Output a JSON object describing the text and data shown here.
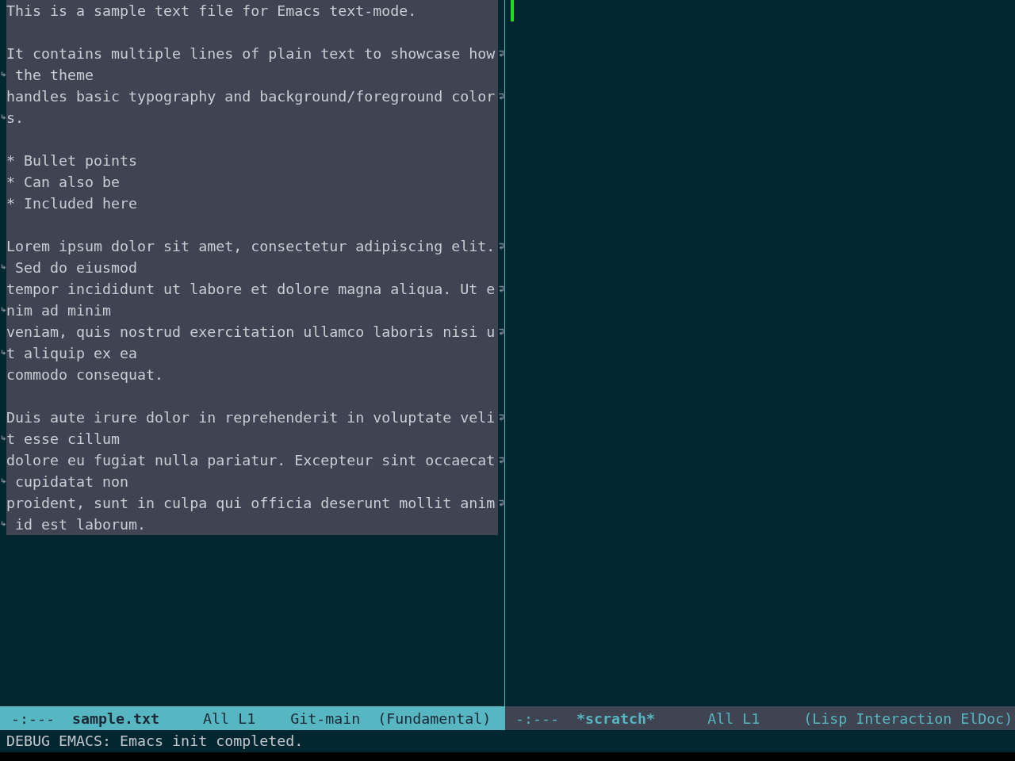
{
  "windows": [
    {
      "region": true,
      "lines": [
        {
          "kind": "text",
          "rows": [
            "This is a sample text file for Emacs text-mode."
          ]
        },
        {
          "kind": "blank"
        },
        {
          "kind": "text",
          "rows": [
            "It contains multiple lines of plain text to showcase how",
            " the theme"
          ]
        },
        {
          "kind": "text",
          "rows": [
            "handles basic typography and background/foreground color",
            "s."
          ]
        },
        {
          "kind": "blank"
        },
        {
          "kind": "text",
          "rows": [
            "* Bullet points"
          ]
        },
        {
          "kind": "text",
          "rows": [
            "* Can also be"
          ]
        },
        {
          "kind": "text",
          "rows": [
            "* Included here"
          ]
        },
        {
          "kind": "blank"
        },
        {
          "kind": "text",
          "rows": [
            "Lorem ipsum dolor sit amet, consectetur adipiscing elit.",
            " Sed do eiusmod"
          ]
        },
        {
          "kind": "text",
          "rows": [
            "tempor incididunt ut labore et dolore magna aliqua. Ut e",
            "nim ad minim"
          ]
        },
        {
          "kind": "text",
          "rows": [
            "veniam, quis nostrud exercitation ullamco laboris nisi u",
            "t aliquip ex ea"
          ]
        },
        {
          "kind": "text",
          "rows": [
            "commodo consequat."
          ]
        },
        {
          "kind": "blank"
        },
        {
          "kind": "text",
          "rows": [
            "Duis aute irure dolor in reprehenderit in voluptate veli",
            "t esse cillum"
          ]
        },
        {
          "kind": "text",
          "rows": [
            "dolore eu fugiat nulla pariatur. Excepteur sint occaecat",
            " cupidatat non"
          ]
        },
        {
          "kind": "text",
          "rows": [
            "proident, sunt in culpa qui officia deserunt mollit anim",
            " id est laborum."
          ]
        }
      ],
      "mode_line": {
        "active": true,
        "segments": [
          {
            "kind": "status",
            "text": "-:---"
          },
          {
            "kind": "buffer",
            "text": "sample.txt"
          },
          {
            "kind": "position",
            "text": "All L1"
          },
          {
            "kind": "vc",
            "text": "Git-main"
          },
          {
            "kind": "mode",
            "text": "(Fundamental)"
          }
        ]
      }
    },
    {
      "cursor": true,
      "mode_line": {
        "active": false,
        "segments": [
          {
            "kind": "status",
            "text": "-:---"
          },
          {
            "kind": "buffer",
            "text": "*scratch*"
          },
          {
            "kind": "position",
            "text": "All L1"
          },
          {
            "kind": "mode",
            "text": "(Lisp Interaction ElDoc)"
          }
        ]
      }
    }
  ],
  "echo_area": {
    "message": "DEBUG EMACS: Emacs init completed."
  }
}
